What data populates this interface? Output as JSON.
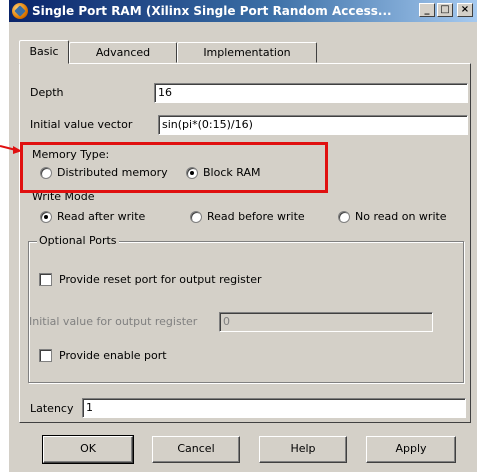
{
  "window": {
    "title": "Single Port RAM (Xilinx Single Port Random Access...",
    "min_glyph": "_",
    "max_glyph": "□",
    "close_glyph": "×"
  },
  "tabs": [
    {
      "label": "Basic",
      "active": true
    },
    {
      "label": "Advanced",
      "active": false
    },
    {
      "label": "Implementation",
      "active": false
    }
  ],
  "basic": {
    "depth_label": "Depth",
    "depth_value": "16",
    "init_label": "Initial value vector",
    "init_value": "sin(pi*(0:15)/16)",
    "memory_type": {
      "label": "Memory Type:",
      "options": [
        "Distributed memory",
        "Block RAM"
      ],
      "selected": "Block RAM"
    },
    "write_mode": {
      "label": "Write Mode",
      "options": [
        "Read after write",
        "Read before write",
        "No read on write"
      ],
      "selected": "Read after write"
    },
    "optional_ports": {
      "label": "Optional Ports",
      "reset_port_label": "Provide reset port for output register",
      "reset_port_checked": false,
      "init_output_label": "Initial value for output register",
      "init_output_value": "0",
      "enable_port_label": "Provide enable port",
      "enable_port_checked": false
    },
    "latency_label": "Latency",
    "latency_value": "1"
  },
  "buttons": {
    "ok": "OK",
    "cancel": "Cancel",
    "help": "Help",
    "apply": "Apply"
  },
  "colors": {
    "highlight": "#e01010",
    "title_bar": "#0a246a",
    "face": "#d4d0c8"
  }
}
